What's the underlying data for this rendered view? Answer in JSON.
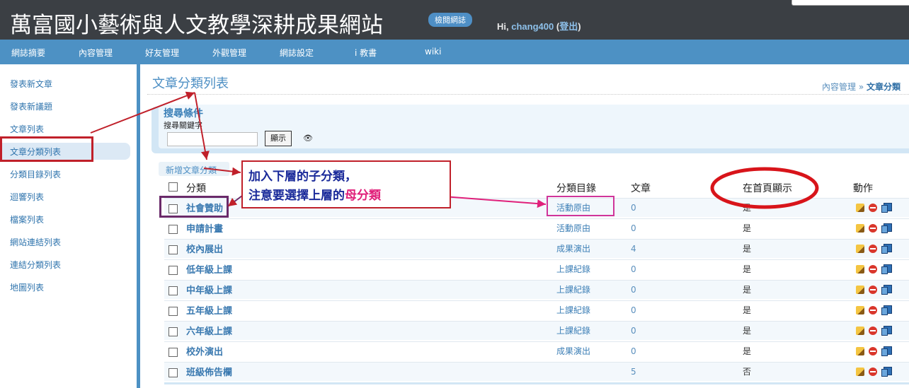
{
  "header": {
    "site_title": "萬富國小藝術與人文教學深耕成果網站",
    "view_blog": "檢閱網誌",
    "greeting_prefix": "Hi,",
    "username": "chang400",
    "logout_open": "(",
    "logout": "登出",
    "logout_close": ")"
  },
  "nav": [
    "網誌摘要",
    "內容管理",
    "好友管理",
    "外觀管理",
    "網誌設定",
    "i 教書",
    "wiki"
  ],
  "sidebar": [
    "發表新文章",
    "發表新議題",
    "文章列表",
    "文章分類列表",
    "分類目錄列表",
    "迴響列表",
    "檔案列表",
    "網站連結列表",
    "連結分類列表",
    "地圖列表"
  ],
  "page": {
    "title": "文章分類列表",
    "breadcrumb_parent": "內容管理",
    "breadcrumb_sep": "»",
    "breadcrumb_current": "文章分類"
  },
  "search": {
    "heading": "搜尋條件",
    "keyword_label": "搜尋關鍵字",
    "keyword_value": "",
    "submit": "顯示"
  },
  "new_category": "新增文章分類",
  "table": {
    "headers": {
      "name": "分類",
      "directory": "分類目錄",
      "posts": "文章",
      "show_home": "在首頁顯示",
      "actions": "動作"
    },
    "rows": [
      {
        "name": "社會贊助",
        "directory": "活動原由",
        "posts": "0",
        "show_home": "是"
      },
      {
        "name": "申請計畫",
        "directory": "活動原由",
        "posts": "0",
        "show_home": "是"
      },
      {
        "name": "校內展出",
        "directory": "成果演出",
        "posts": "4",
        "show_home": "是"
      },
      {
        "name": "低年級上課",
        "directory": "上課紀錄",
        "posts": "0",
        "show_home": "是"
      },
      {
        "name": "中年級上課",
        "directory": "上課紀錄",
        "posts": "0",
        "show_home": "是"
      },
      {
        "name": "五年級上課",
        "directory": "上課紀錄",
        "posts": "0",
        "show_home": "是"
      },
      {
        "name": "六年級上課",
        "directory": "上課紀錄",
        "posts": "0",
        "show_home": "是"
      },
      {
        "name": "校外演出",
        "directory": "成果演出",
        "posts": "0",
        "show_home": "是"
      },
      {
        "name": "班級佈告欄",
        "directory": "",
        "posts": "5",
        "show_home": "否"
      }
    ]
  },
  "annotation": {
    "line1": "加入下層的子分類，",
    "line2_prefix": "注意要選擇上層的",
    "line2_emphasis": "母分類"
  },
  "colors": {
    "header_bg": "#3b3f44",
    "nav_bg": "#4d91c4",
    "annotation_red": "#c0202a",
    "annotation_pink": "#e0207a"
  }
}
